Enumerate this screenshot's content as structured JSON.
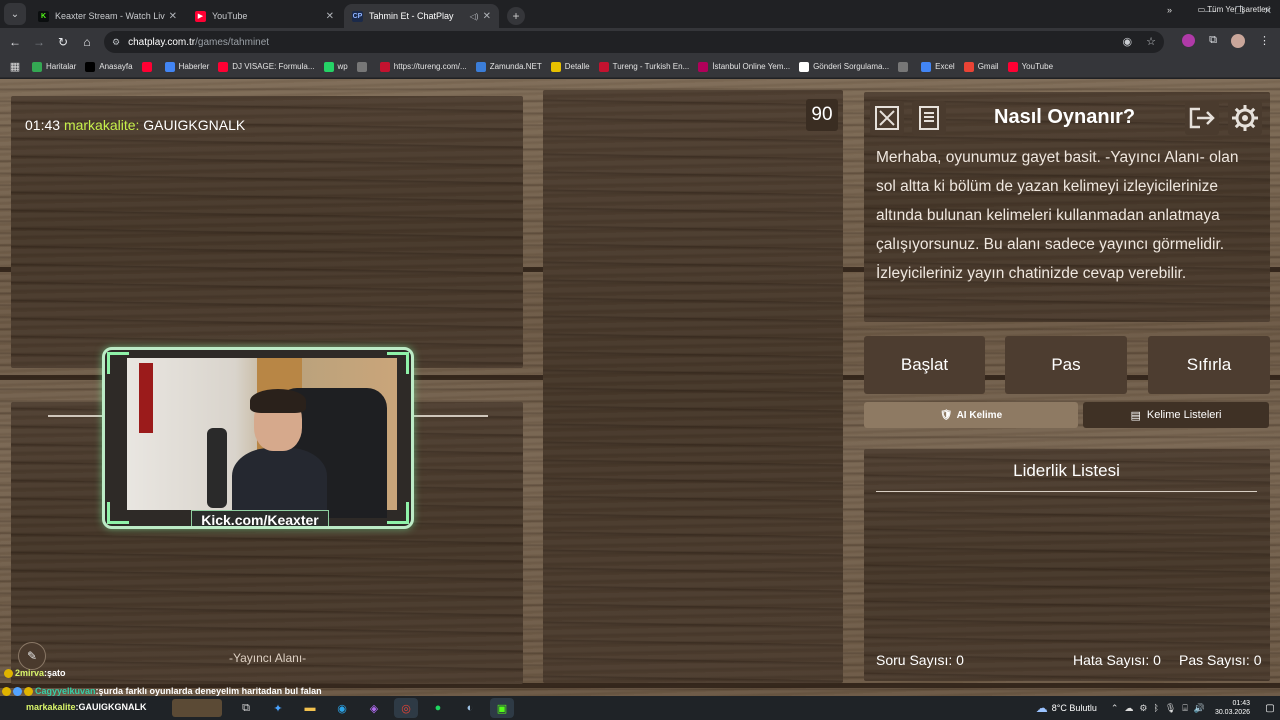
{
  "browser": {
    "tabs": [
      {
        "title": "Keaxter Stream - Watch Live on",
        "favicon": "kick-icon",
        "color": "#53fc18",
        "active": false
      },
      {
        "title": "YouTube",
        "favicon": "youtube-icon",
        "color": "#ff0033",
        "active": false
      },
      {
        "title": "Tahmin Et - ChatPlay",
        "favicon": "chatplay-icon",
        "color": "#4c8bf5",
        "active": true
      }
    ],
    "url_host": "chatplay.com.tr",
    "url_path": "/games/tahminet",
    "bookmarks": [
      {
        "label": "Haritalar",
        "color": "#34a853"
      },
      {
        "label": "Anasayfa",
        "color": "#000000"
      },
      {
        "label": "",
        "color": "#ff0033"
      },
      {
        "label": "Haberler",
        "color": "#4285f4"
      },
      {
        "label": "DJ VISAGE: Formula...",
        "color": "#ff0033"
      },
      {
        "label": "wp",
        "color": "#25d366"
      },
      {
        "label": "",
        "color": "#777777"
      },
      {
        "label": "https://tureng.com/...",
        "color": "#c4122f"
      },
      {
        "label": "Zamunda.NET",
        "color": "#3b7dd8"
      },
      {
        "label": "Detalle",
        "color": "#e8c100"
      },
      {
        "label": "Tureng - Turkish En...",
        "color": "#c4122f"
      },
      {
        "label": "İstanbul Online Yem...",
        "color": "#b1005a"
      },
      {
        "label": "Gönderi Sorgulama...",
        "color": "#ffffff"
      },
      {
        "label": "",
        "color": "#777777"
      },
      {
        "label": "Excel",
        "color": "#4285f4"
      },
      {
        "label": "Gmail",
        "color": "#ea4335"
      },
      {
        "label": "YouTube",
        "color": "#ff0033"
      }
    ],
    "all_bookmarks": "Tüm Yer İşaretleri"
  },
  "game": {
    "chat": {
      "time": "01:43",
      "user": "markakalite:",
      "message": "GAUIGKGNALK"
    },
    "timer": "90",
    "how_title": "Nasıl Oynanır?",
    "how_text": "Merhaba, oyunumuz gayet basit. -Yayıncı Alanı- olan sol altta ki bölüm de yazan kelimeyi izleyicilerinize altında bulunan kelimeleri kullanmadan anlatmaya çalışıyorsunuz. Bu alanı sadece yayıncı görmelidir. İzleyicileriniz yayın chatinizde cevap verebilir.",
    "buttons": {
      "start": "Başlat",
      "pass": "Pas",
      "reset": "Sıfırla"
    },
    "ai_word": "AI Kelime",
    "word_lists": "Kelime Listeleri",
    "leaderboard": "Liderlik Listesi",
    "stats": {
      "questions": "Soru Sayısı: 0",
      "errors": "Hata Sayısı: 0",
      "passes": "Pas Sayısı: 0"
    },
    "streamer_area": "-Yayıncı Alanı-"
  },
  "stream_overlay": {
    "cam_label": "Kick.com/Keaxter",
    "chat": [
      {
        "user": "2mirva",
        "sep": " : ",
        "msg": "şato"
      },
      {
        "user": "Cagyyelkuvan",
        "sep": " : ",
        "msg": "şurda farklı oyunlarda deneyelim haritadan bul falan"
      },
      {
        "user": "markakalite",
        "sep": " : ",
        "msg": "GAUIGKGNALK"
      }
    ]
  },
  "taskbar": {
    "weather": "8°C Bulutlu",
    "time": "01:43",
    "date": "30.03.2026"
  },
  "colors": {
    "chat_user": "#c6f04b",
    "ai_button": "#8e7a63",
    "cam_border": "#bcebc6"
  }
}
